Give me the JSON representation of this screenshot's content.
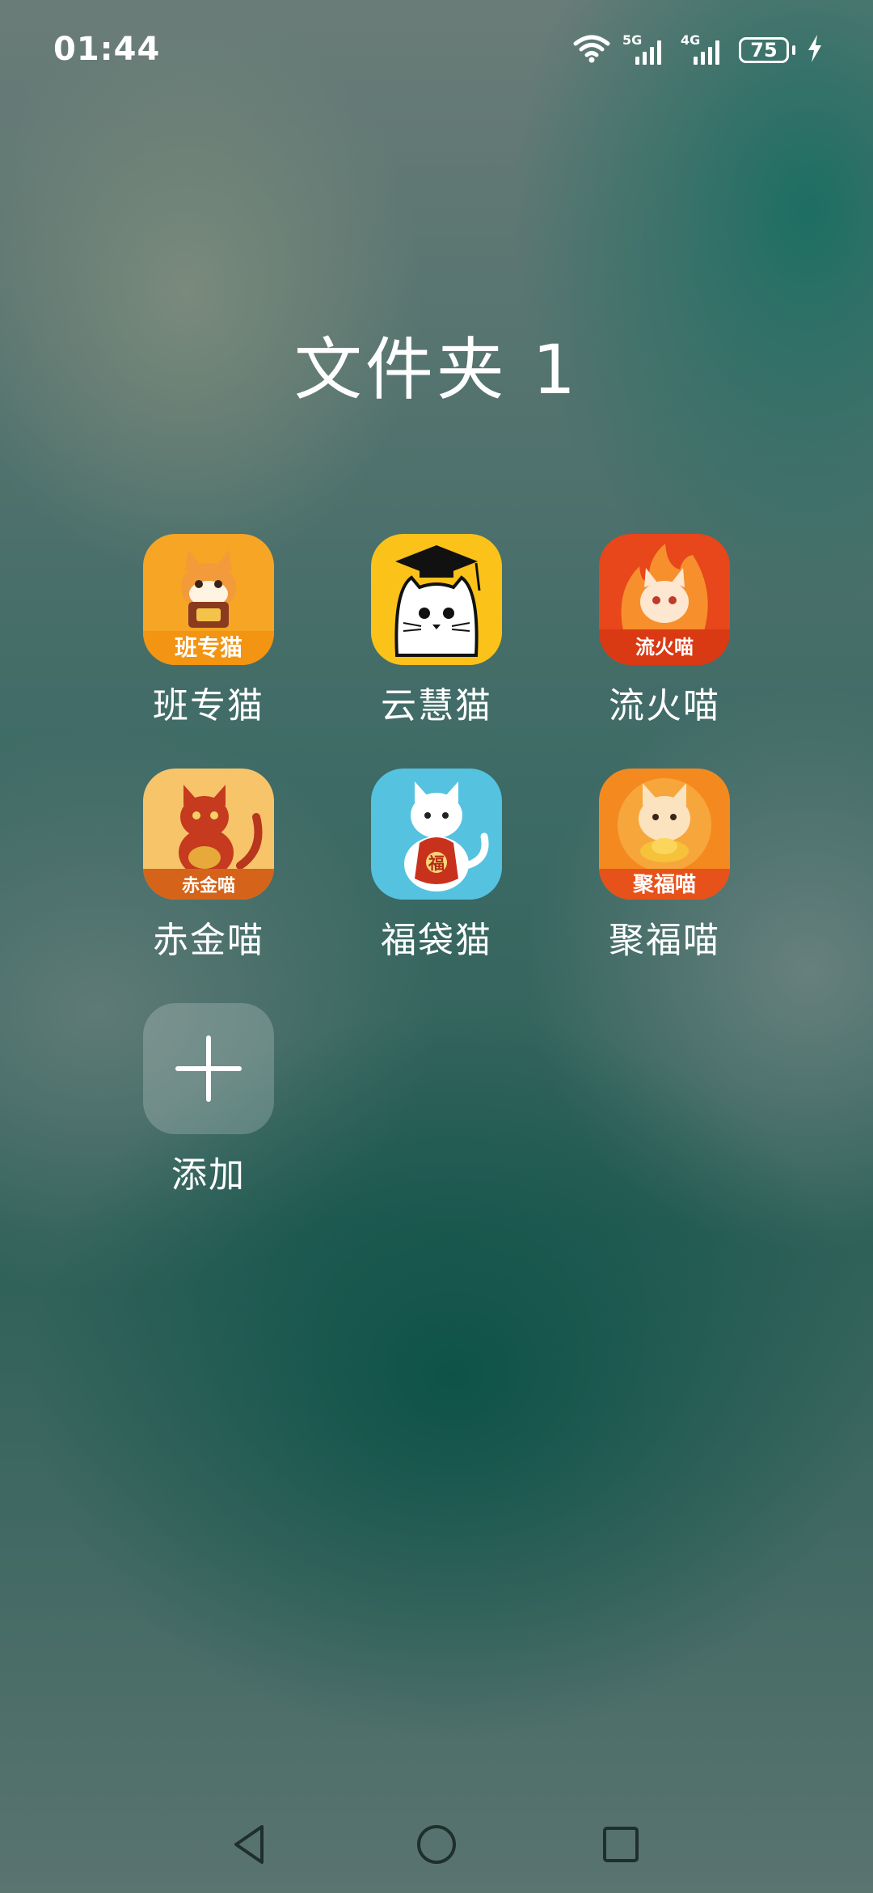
{
  "status_bar": {
    "time": "01:44",
    "wifi_icon": "wifi-icon",
    "signal_1_label": "5G",
    "signal_2_label": "4G",
    "battery_level": "75",
    "charging_icon": "lightning-bolt-icon"
  },
  "folder": {
    "title": "文件夹 1",
    "apps": [
      {
        "label": "班专猫",
        "icon_text": "班专猫",
        "icon": "cat-holding-box-icon"
      },
      {
        "label": "云慧猫",
        "icon": "cat-graduation-cap-icon"
      },
      {
        "label": "流火喵",
        "icon_text": "流火喵",
        "icon": "cat-fire-icon"
      },
      {
        "label": "赤金喵",
        "icon_text": "赤金喵",
        "icon": "golden-red-cat-icon"
      },
      {
        "label": "福袋猫",
        "icon_text": "福",
        "icon": "cat-lucky-bag-icon"
      },
      {
        "label": "聚福喵",
        "icon_text": "聚福喵",
        "icon": "cat-gold-ingot-icon"
      }
    ],
    "add": {
      "label": "添加",
      "icon": "plus-icon"
    }
  },
  "nav_bar": {
    "back_icon": "triangle-back-icon",
    "home_icon": "circle-home-icon",
    "recents_icon": "square-recents-icon"
  },
  "colors": {
    "text": "#ffffff",
    "banzhuan_bg": "#f6a524",
    "yunhui_bg": "#fbc21a",
    "liuhuo_bg": "#e8461b",
    "chijin_bg": "#f7c46a",
    "fudai_bg": "#55c2e0",
    "jufu_bg": "#f48a1f"
  }
}
